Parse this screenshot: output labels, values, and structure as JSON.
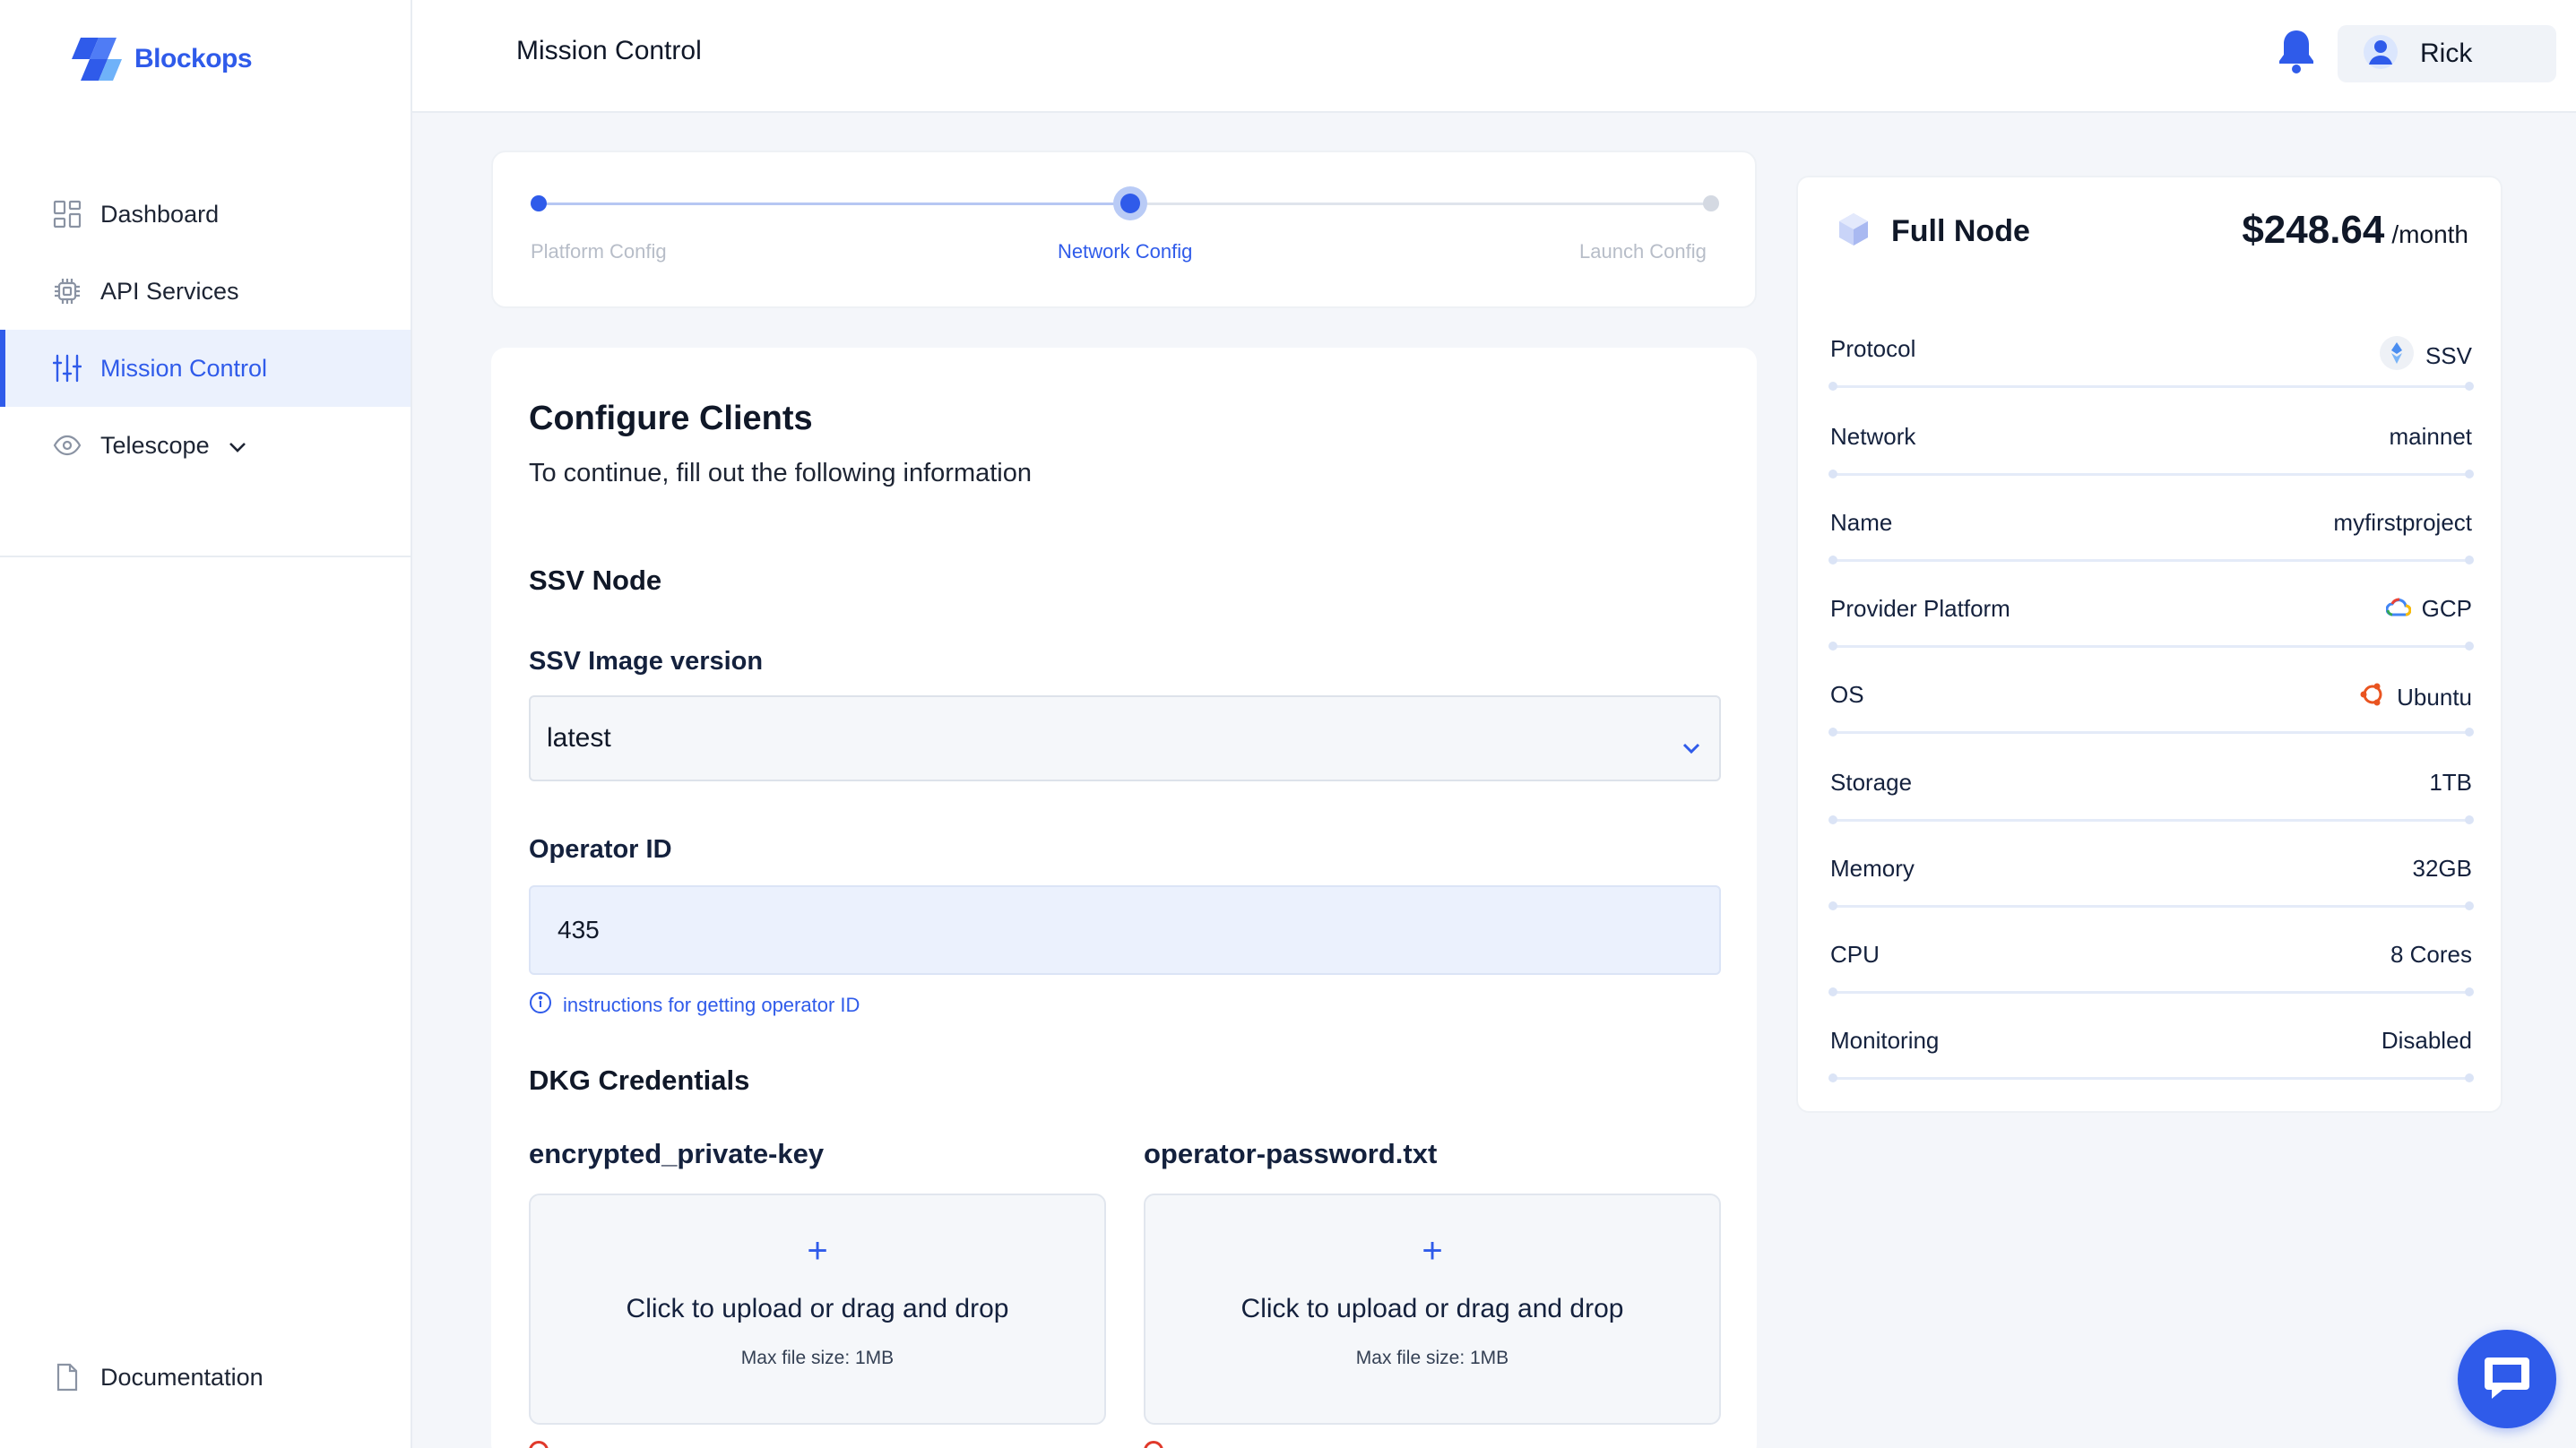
{
  "brand": {
    "name": "Blockops",
    "color": "#2f5bea"
  },
  "sidebar": {
    "items": [
      {
        "label": "Dashboard",
        "icon": "dashboard-icon"
      },
      {
        "label": "API Services",
        "icon": "chip-icon"
      },
      {
        "label": "Mission Control",
        "icon": "sliders-icon",
        "active": true
      },
      {
        "label": "Telescope",
        "icon": "eye-icon",
        "expandable": true
      }
    ],
    "documentation": "Documentation"
  },
  "header": {
    "title": "Mission Control",
    "user": "Rick"
  },
  "stepper": {
    "steps": [
      {
        "label": "Platform Config",
        "state": "done"
      },
      {
        "label": "Network Config",
        "state": "current"
      },
      {
        "label": "Launch Config",
        "state": "pending"
      }
    ]
  },
  "form": {
    "title": "Configure Clients",
    "subtitle": "To continue, fill out the following information",
    "section_node": "SSV Node",
    "image_version": {
      "label": "SSV Image version",
      "value": "latest"
    },
    "operator_id": {
      "label": "Operator ID",
      "value": "435",
      "hint": "instructions for getting operator ID"
    },
    "section_dkg": "DKG Credentials",
    "uploads": [
      {
        "label": "encrypted_private-key",
        "text": "Click to upload or drag and drop",
        "size": "Max file size: 1MB"
      },
      {
        "label": "operator-password.txt",
        "text": "Click to upload or drag and drop",
        "size": "Max file size: 1MB"
      }
    ]
  },
  "summary": {
    "title": "Full Node",
    "price": "$248.64",
    "price_unit": "/month",
    "rows": [
      {
        "key": "Protocol",
        "value": "SSV",
        "icon": "ssv-icon"
      },
      {
        "key": "Network",
        "value": "mainnet"
      },
      {
        "key": "Name",
        "value": "myfirstproject"
      },
      {
        "key": "Provider Platform",
        "value": "GCP",
        "icon": "gcp-icon"
      },
      {
        "key": "OS",
        "value": "Ubuntu",
        "icon": "ubuntu-icon"
      },
      {
        "key": "Storage",
        "value": "1TB"
      },
      {
        "key": "Memory",
        "value": "32GB"
      },
      {
        "key": "CPU",
        "value": "8 Cores"
      },
      {
        "key": "Monitoring",
        "value": "Disabled"
      }
    ]
  }
}
